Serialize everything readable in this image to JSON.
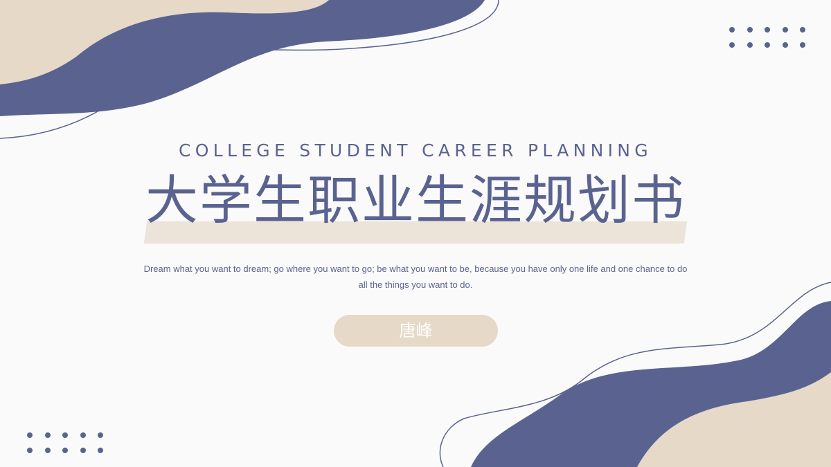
{
  "colors": {
    "primary": "#5a6390",
    "beige": "#e6d9c8",
    "highlight": "#ece3d9",
    "background": "#fbfafa"
  },
  "slide": {
    "subtitle_en": "COLLEGE STUDENT CAREER PLANNING",
    "title_cn": "大学生职业生涯规划书",
    "quote": "Dream what you want to dream; go where you want to go; be what you want to be, because you have only one life and one chance to do all the things you want to do.",
    "author": "唐峰"
  }
}
